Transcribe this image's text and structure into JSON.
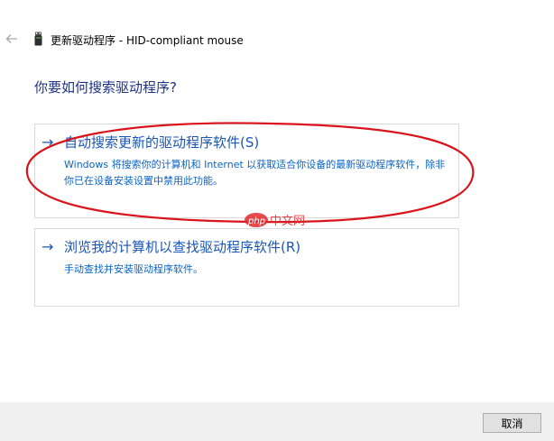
{
  "window": {
    "title": "更新驱动程序 - HID-compliant mouse",
    "back_icon": "back-arrow-icon",
    "device_icon": "usb-device-icon"
  },
  "heading": "你要如何搜索驱动程序?",
  "options": [
    {
      "arrow": "→",
      "title": "自动搜索更新的驱动程序软件(S)",
      "description": "Windows 将搜索你的计算机和 Internet 以获取适合你设备的最新驱动程序软件，除非你已在设备安装设置中禁用此功能。",
      "highlighted": true
    },
    {
      "arrow": "→",
      "title": "浏览我的计算机以查找驱动程序软件(R)",
      "description": "手动查找并安装驱动程序软件。",
      "highlighted": false
    }
  ],
  "footer": {
    "cancel_label": "取消"
  },
  "watermark": {
    "logo_text": "php",
    "site_text": "中文网"
  },
  "colors": {
    "heading": "#1e3287",
    "link": "#1a56b6",
    "annotation_red": "#d9141c",
    "footer_bg": "#f0f0f0"
  }
}
